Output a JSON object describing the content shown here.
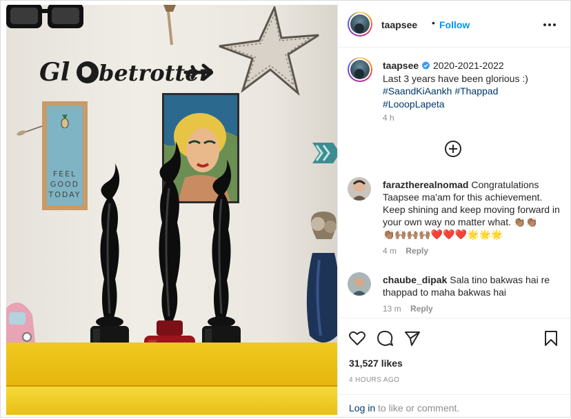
{
  "post": {
    "username": "taapsee",
    "verified": true,
    "separator": "•",
    "follow_label": "Follow",
    "more_icon": "more-horizontal-icon"
  },
  "photo": {
    "frame_text": [
      "FEEL",
      "GOOD",
      "TODAY"
    ],
    "wall_sign": "Globetrotter"
  },
  "caption": {
    "username": "taapsee",
    "verified": true,
    "text_line1": "2020-2021-2022",
    "text_line2": "Last 3 years have been glorious :)",
    "hashtags": [
      "#SaandKiAankh",
      "#Thappad",
      "#LooopLapeta"
    ],
    "time": "4 h"
  },
  "comments": [
    {
      "username": "faraztherealnomad",
      "text": "Congratulations Taapsee ma'am for this achievement. Keep shining and keep moving forward in your own way no matter what.",
      "emoji_line1": "👏🏽👏🏽",
      "emoji_line2": "👏🏽🙌🏽🙌🏽🙌🏽❤️❤️❤️🌟🌟🌟",
      "time": "4 m",
      "reply_label": "Reply"
    },
    {
      "username": "chaube_dipak",
      "text": "Sala tino bakwas hai re thappad to maha bakwas hai",
      "time": "13 m",
      "reply_label": "Reply"
    }
  ],
  "actions": {
    "likes": "31,527 likes",
    "age": "4 HOURS AGO",
    "login_link": "Log in",
    "login_rest": " to like or comment."
  },
  "colors": {
    "link_blue": "#0095f6",
    "hashtag_blue": "#00376b",
    "verified_blue": "#3897f0",
    "muted": "#8e8e8e",
    "shelf_yellow": "#e6b80f"
  }
}
